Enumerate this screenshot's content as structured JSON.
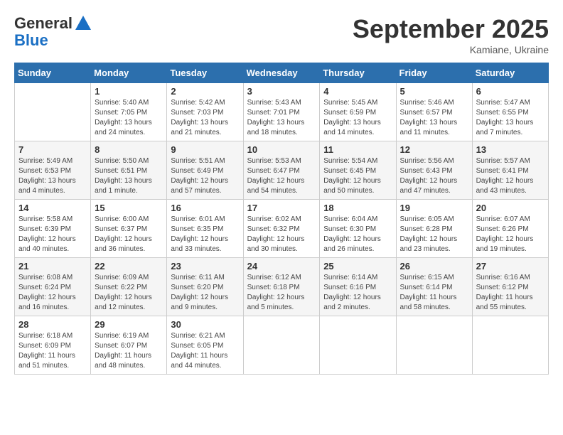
{
  "header": {
    "logo_line1": "General",
    "logo_line2": "Blue",
    "month_title": "September 2025",
    "location": "Kamiane, Ukraine"
  },
  "columns": [
    "Sunday",
    "Monday",
    "Tuesday",
    "Wednesday",
    "Thursday",
    "Friday",
    "Saturday"
  ],
  "weeks": [
    [
      {
        "day": "",
        "info": ""
      },
      {
        "day": "1",
        "info": "Sunrise: 5:40 AM\nSunset: 7:05 PM\nDaylight: 13 hours\nand 24 minutes."
      },
      {
        "day": "2",
        "info": "Sunrise: 5:42 AM\nSunset: 7:03 PM\nDaylight: 13 hours\nand 21 minutes."
      },
      {
        "day": "3",
        "info": "Sunrise: 5:43 AM\nSunset: 7:01 PM\nDaylight: 13 hours\nand 18 minutes."
      },
      {
        "day": "4",
        "info": "Sunrise: 5:45 AM\nSunset: 6:59 PM\nDaylight: 13 hours\nand 14 minutes."
      },
      {
        "day": "5",
        "info": "Sunrise: 5:46 AM\nSunset: 6:57 PM\nDaylight: 13 hours\nand 11 minutes."
      },
      {
        "day": "6",
        "info": "Sunrise: 5:47 AM\nSunset: 6:55 PM\nDaylight: 13 hours\nand 7 minutes."
      }
    ],
    [
      {
        "day": "7",
        "info": "Sunrise: 5:49 AM\nSunset: 6:53 PM\nDaylight: 13 hours\nand 4 minutes."
      },
      {
        "day": "8",
        "info": "Sunrise: 5:50 AM\nSunset: 6:51 PM\nDaylight: 13 hours\nand 1 minute."
      },
      {
        "day": "9",
        "info": "Sunrise: 5:51 AM\nSunset: 6:49 PM\nDaylight: 12 hours\nand 57 minutes."
      },
      {
        "day": "10",
        "info": "Sunrise: 5:53 AM\nSunset: 6:47 PM\nDaylight: 12 hours\nand 54 minutes."
      },
      {
        "day": "11",
        "info": "Sunrise: 5:54 AM\nSunset: 6:45 PM\nDaylight: 12 hours\nand 50 minutes."
      },
      {
        "day": "12",
        "info": "Sunrise: 5:56 AM\nSunset: 6:43 PM\nDaylight: 12 hours\nand 47 minutes."
      },
      {
        "day": "13",
        "info": "Sunrise: 5:57 AM\nSunset: 6:41 PM\nDaylight: 12 hours\nand 43 minutes."
      }
    ],
    [
      {
        "day": "14",
        "info": "Sunrise: 5:58 AM\nSunset: 6:39 PM\nDaylight: 12 hours\nand 40 minutes."
      },
      {
        "day": "15",
        "info": "Sunrise: 6:00 AM\nSunset: 6:37 PM\nDaylight: 12 hours\nand 36 minutes."
      },
      {
        "day": "16",
        "info": "Sunrise: 6:01 AM\nSunset: 6:35 PM\nDaylight: 12 hours\nand 33 minutes."
      },
      {
        "day": "17",
        "info": "Sunrise: 6:02 AM\nSunset: 6:32 PM\nDaylight: 12 hours\nand 30 minutes."
      },
      {
        "day": "18",
        "info": "Sunrise: 6:04 AM\nSunset: 6:30 PM\nDaylight: 12 hours\nand 26 minutes."
      },
      {
        "day": "19",
        "info": "Sunrise: 6:05 AM\nSunset: 6:28 PM\nDaylight: 12 hours\nand 23 minutes."
      },
      {
        "day": "20",
        "info": "Sunrise: 6:07 AM\nSunset: 6:26 PM\nDaylight: 12 hours\nand 19 minutes."
      }
    ],
    [
      {
        "day": "21",
        "info": "Sunrise: 6:08 AM\nSunset: 6:24 PM\nDaylight: 12 hours\nand 16 minutes."
      },
      {
        "day": "22",
        "info": "Sunrise: 6:09 AM\nSunset: 6:22 PM\nDaylight: 12 hours\nand 12 minutes."
      },
      {
        "day": "23",
        "info": "Sunrise: 6:11 AM\nSunset: 6:20 PM\nDaylight: 12 hours\nand 9 minutes."
      },
      {
        "day": "24",
        "info": "Sunrise: 6:12 AM\nSunset: 6:18 PM\nDaylight: 12 hours\nand 5 minutes."
      },
      {
        "day": "25",
        "info": "Sunrise: 6:14 AM\nSunset: 6:16 PM\nDaylight: 12 hours\nand 2 minutes."
      },
      {
        "day": "26",
        "info": "Sunrise: 6:15 AM\nSunset: 6:14 PM\nDaylight: 11 hours\nand 58 minutes."
      },
      {
        "day": "27",
        "info": "Sunrise: 6:16 AM\nSunset: 6:12 PM\nDaylight: 11 hours\nand 55 minutes."
      }
    ],
    [
      {
        "day": "28",
        "info": "Sunrise: 6:18 AM\nSunset: 6:09 PM\nDaylight: 11 hours\nand 51 minutes."
      },
      {
        "day": "29",
        "info": "Sunrise: 6:19 AM\nSunset: 6:07 PM\nDaylight: 11 hours\nand 48 minutes."
      },
      {
        "day": "30",
        "info": "Sunrise: 6:21 AM\nSunset: 6:05 PM\nDaylight: 11 hours\nand 44 minutes."
      },
      {
        "day": "",
        "info": ""
      },
      {
        "day": "",
        "info": ""
      },
      {
        "day": "",
        "info": ""
      },
      {
        "day": "",
        "info": ""
      }
    ]
  ]
}
